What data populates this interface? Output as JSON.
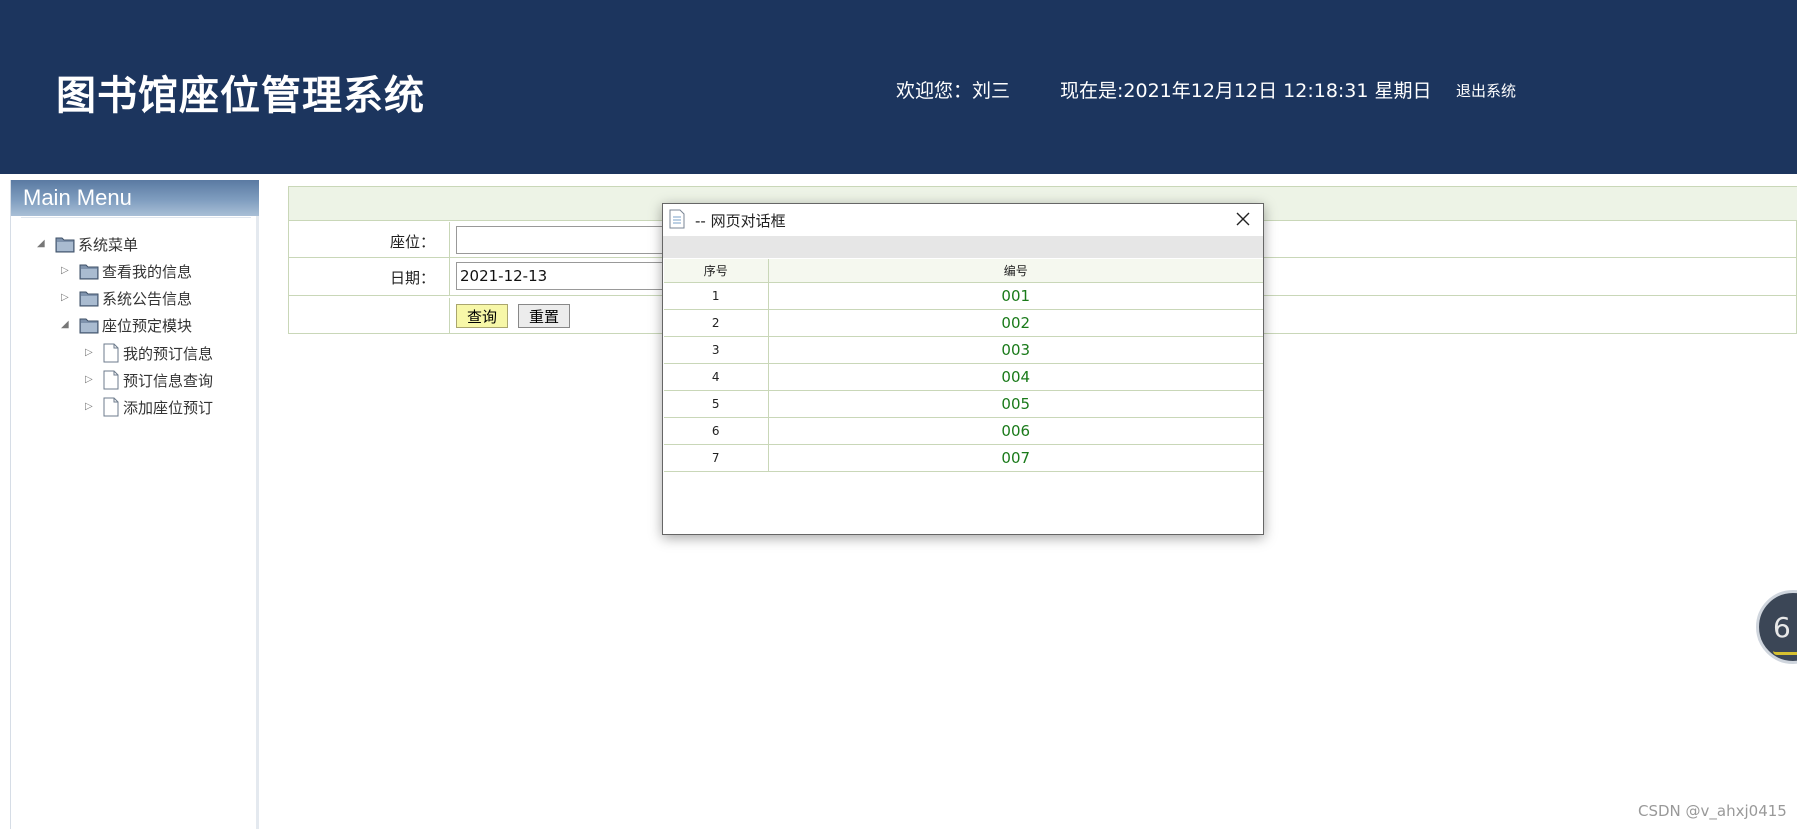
{
  "header": {
    "title": "图书馆座位管理系统",
    "welcome": "欢迎您：刘三",
    "clock": "现在是:2021年12月12日 12:18:31 星期日",
    "logout": "退出系统"
  },
  "sidebar": {
    "heading": "Main Menu",
    "root": {
      "label": "系统菜单"
    },
    "items": [
      {
        "label": "查看我的信息"
      },
      {
        "label": "系统公告信息"
      },
      {
        "label": "座位预定模块"
      }
    ],
    "sub_items": [
      {
        "label": "我的预订信息"
      },
      {
        "label": "预订信息查询"
      },
      {
        "label": "添加座位预订"
      }
    ]
  },
  "form": {
    "seat_label": "座位：",
    "seat_value": "",
    "date_label": "日期：",
    "date_value": "2021-12-13",
    "query_button": "查询",
    "reset_button": "重置"
  },
  "dialog": {
    "title": "-- 网页对话框",
    "columns": [
      "序号",
      "编号"
    ],
    "rows": [
      {
        "index": "1",
        "code": "001"
      },
      {
        "index": "2",
        "code": "002"
      },
      {
        "index": "3",
        "code": "003"
      },
      {
        "index": "4",
        "code": "004"
      },
      {
        "index": "5",
        "code": "005"
      },
      {
        "index": "6",
        "code": "006"
      },
      {
        "index": "7",
        "code": "007"
      }
    ]
  },
  "badge": {
    "text": "6"
  },
  "watermark": "CSDN @v_ahxj0415",
  "colors": {
    "header_bg": "#1c355e",
    "link_green": "#1a7a1a",
    "grid_border": "#c9d7b8"
  }
}
